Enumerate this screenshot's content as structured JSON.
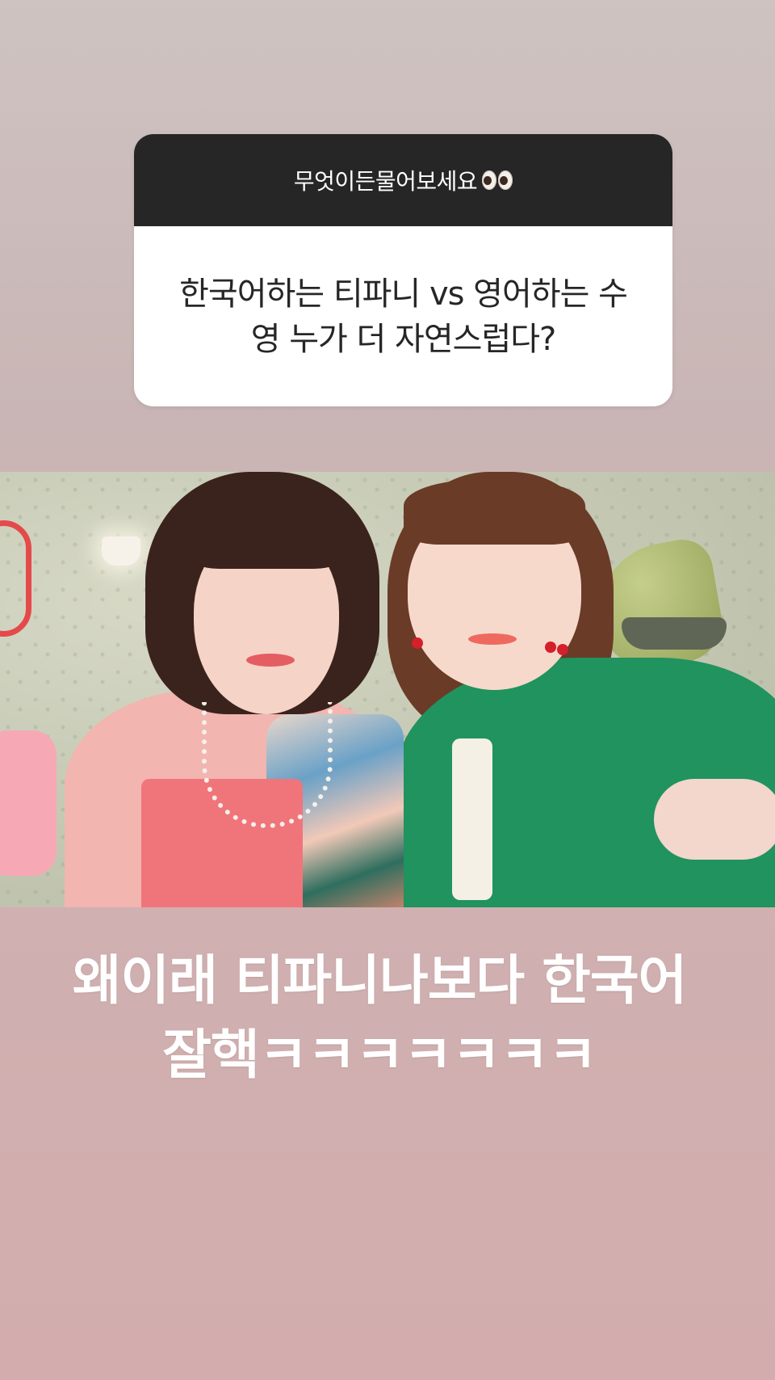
{
  "question_sticker": {
    "header": "무엇이든물어보세요",
    "header_emoji": "eyes-emoji",
    "question": "한국어하는 티파니 vs 영어하는 수영 누가 더 자연스럽다?"
  },
  "photo": {
    "description_icon": "selfie-photo"
  },
  "caption": {
    "line1": "왜이래 티파니나보다 한국어",
    "line2": "잘핵ㅋㅋㅋㅋㅋㅋㅋ"
  },
  "colors": {
    "sticker_header_bg": "#262626",
    "sticker_body_bg": "#ffffff",
    "caption_text": "#ffffff",
    "background_top": "#cec3c1",
    "background_bottom": "#d3adad"
  }
}
